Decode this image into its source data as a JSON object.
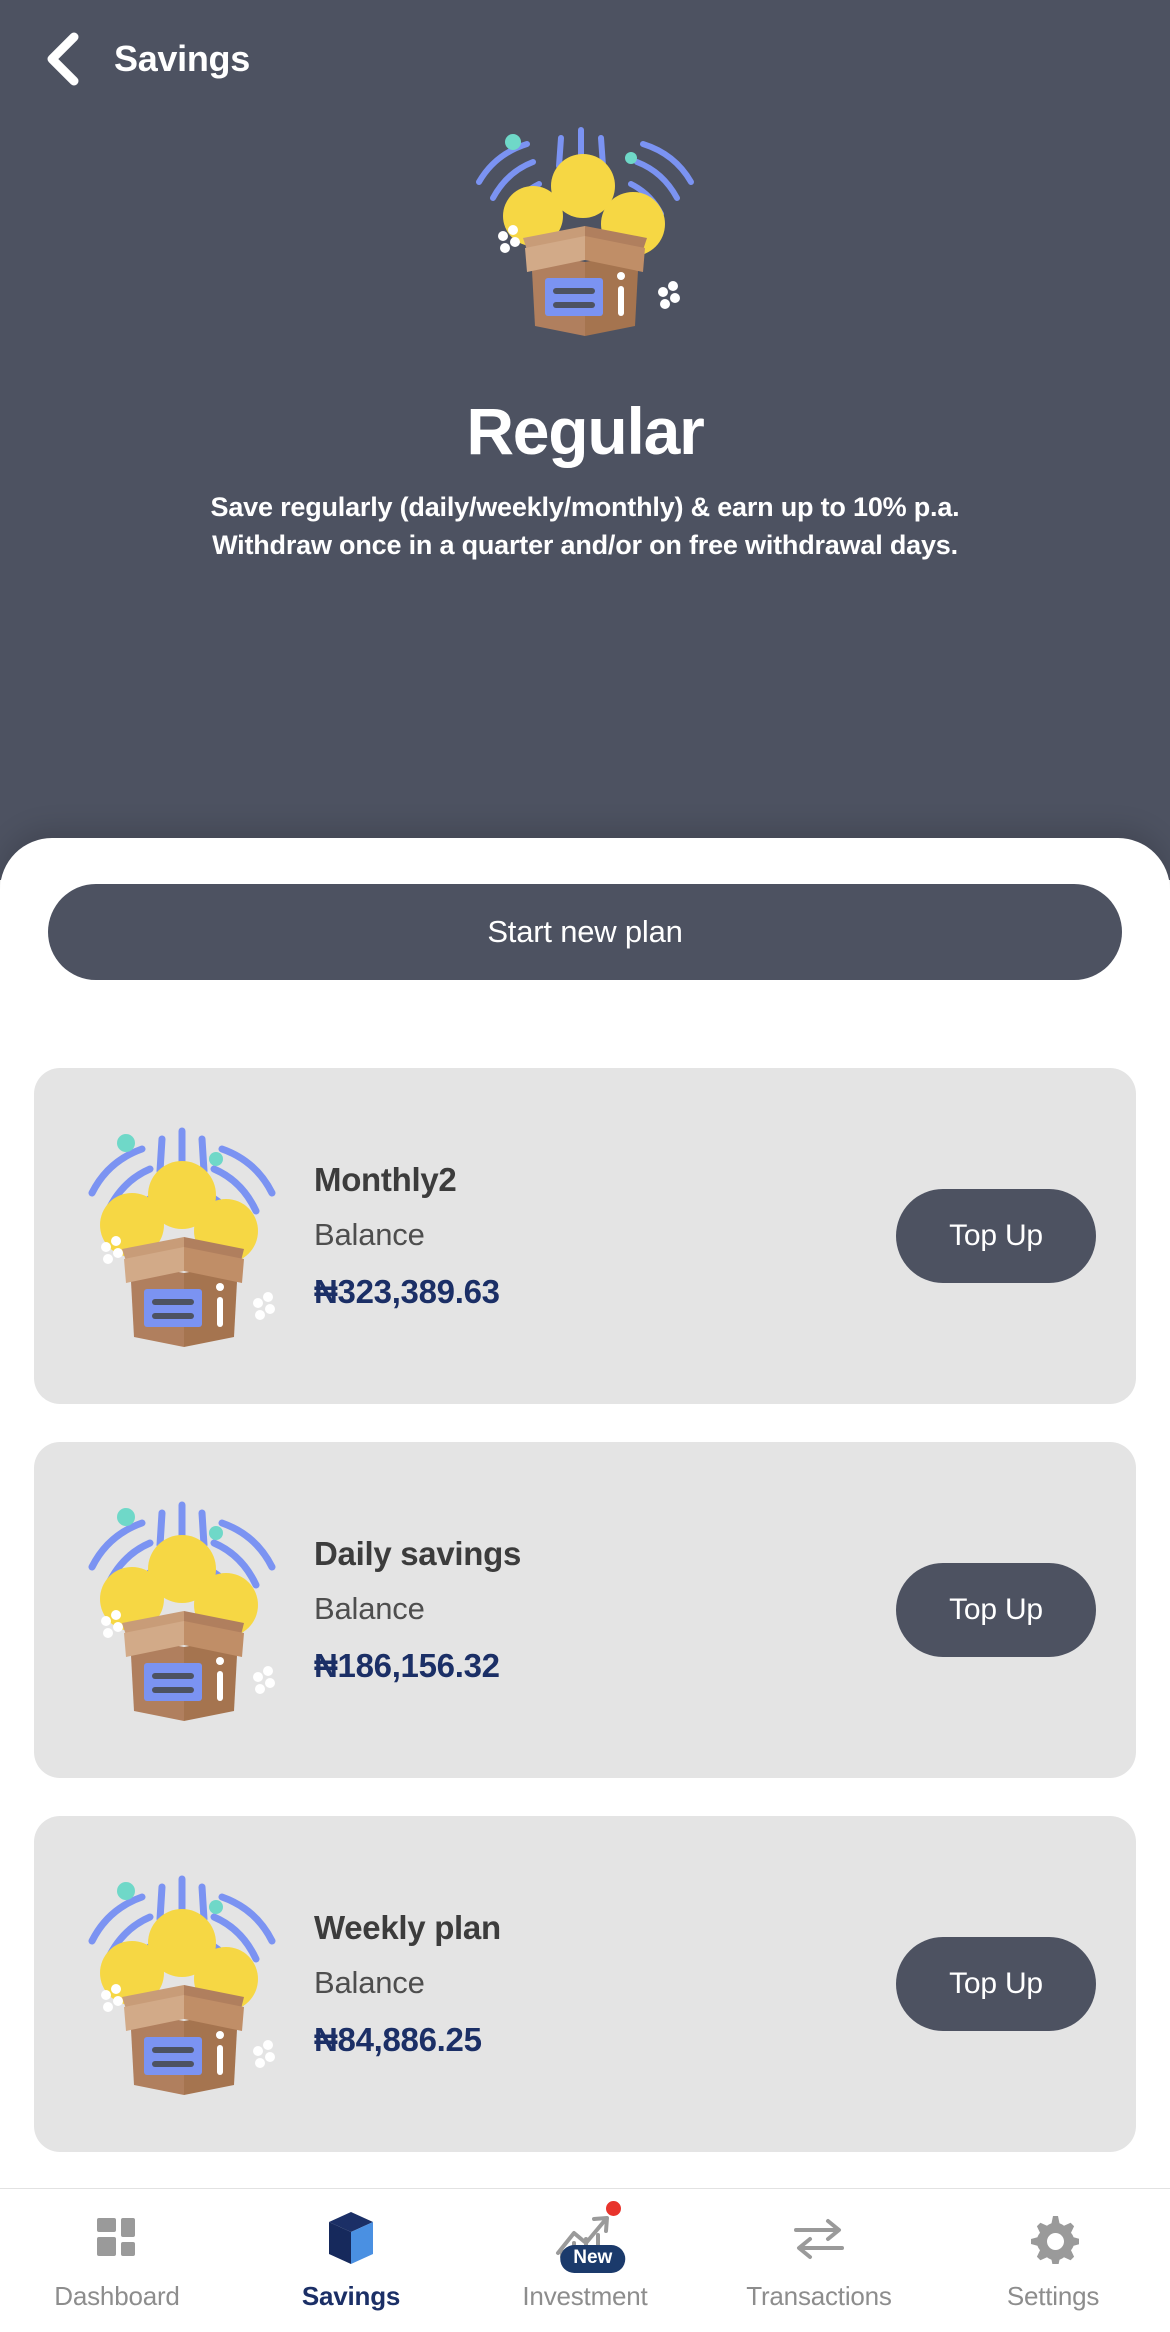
{
  "header": {
    "back_icon": "chevron-left-icon",
    "title": "Savings"
  },
  "hero": {
    "illustration": "open-box-with-coins-illustration",
    "title": "Regular",
    "description_line1": "Save regularly (daily/weekly/monthly) & earn up to 10% p.a.",
    "description_line2": "Withdraw once in a quarter and/or on free withdrawal days.",
    "background_color": "#4d5261"
  },
  "sheet": {
    "start_plan_label": "Start new plan"
  },
  "plans": {
    "balance_label": "Balance",
    "topup_label": "Top Up",
    "items": [
      {
        "name": "Monthly2",
        "balance_label": "Balance",
        "amount": "₦323,389.63",
        "topup_label": "Top Up"
      },
      {
        "name": "Daily savings",
        "balance_label": "Balance",
        "amount": "₦186,156.32",
        "topup_label": "Top Up"
      },
      {
        "name": "Weekly plan",
        "balance_label": "Balance",
        "amount": "₦84,886.25",
        "topup_label": "Top Up"
      }
    ]
  },
  "bottom_nav": {
    "items": [
      {
        "label": "Dashboard",
        "icon": "grid-dashboard-icon",
        "active": false
      },
      {
        "label": "Savings",
        "icon": "cube-box-icon",
        "active": true
      },
      {
        "label": "Investment",
        "icon": "growth-chart-icon",
        "active": false,
        "badge": "New"
      },
      {
        "label": "Transactions",
        "icon": "swap-arrows-icon",
        "active": false
      },
      {
        "label": "Settings",
        "icon": "gear-icon",
        "active": false
      }
    ]
  },
  "colors": {
    "slate": "#4d5261",
    "navy": "#1b2f66",
    "card_gray": "#e4e4e4",
    "coin_yellow": "#f6d744",
    "arc_blue": "#7b93f2",
    "box_brown": "#b07f5e",
    "teal": "#6fd8c8",
    "badge_red": "#e8342c"
  }
}
